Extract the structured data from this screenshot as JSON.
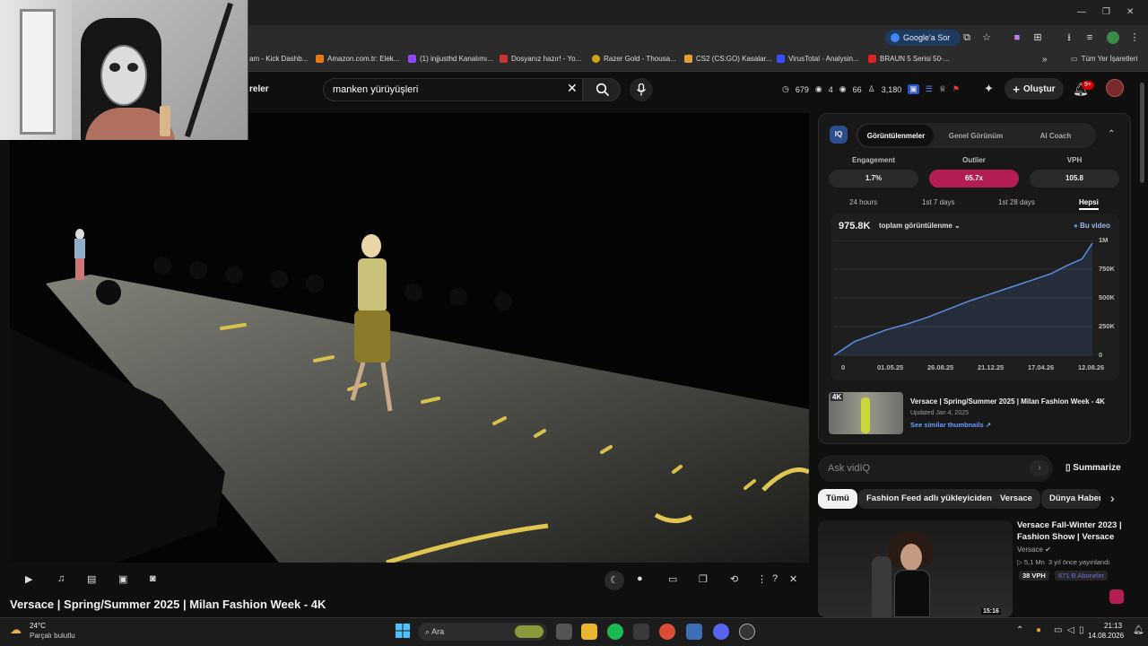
{
  "browser": {
    "google_btn": "Google'a Sor",
    "bookmarks": [
      {
        "label": "am - Kick Dashb..."
      },
      {
        "label": "Amazon.com.tr: Elek..."
      },
      {
        "label": "(1) injjusthd Kanalımı..."
      },
      {
        "label": "Dosyanız hazır! - Yo..."
      },
      {
        "label": "Razer Gold - Thousa..."
      },
      {
        "label": "CS2 (CS:GO) Kasalar..."
      },
      {
        "label": "VirusTotal - Analysin..."
      },
      {
        "label": "BRAUN 5 Serisi 50-..."
      }
    ],
    "all_bookmarks": "Tüm Yer İşaretleri",
    "bm_more": "»"
  },
  "yt": {
    "nav_label": "reler",
    "search_value": "manken yürüyüşleri",
    "stats": [
      "679",
      "4",
      "66",
      "3,180"
    ],
    "create_label": "Oluştur",
    "notif_count": "9+"
  },
  "video": {
    "title": "Versace | Spring/Summer 2025 | Milan Fashion Week - 4K"
  },
  "viq": {
    "logo": "IQ",
    "tabs": [
      "Görüntülenmeler",
      "Genel Görünüm",
      "AI Coach"
    ],
    "metrics": [
      {
        "label": "Engagement",
        "value": "1.7%"
      },
      {
        "label": "Outlier",
        "value": "65.7x"
      },
      {
        "label": "VPH",
        "value": "105.8"
      }
    ],
    "ranges": [
      "24 hours",
      "1st 7 days",
      "1st 28 days",
      "Hepsi"
    ],
    "views_total": "975.8K",
    "views_dropdown": "toplam görüntülenme",
    "legend": "Bu video",
    "related_title": "Versace | Spring/Summer 2025 | Milan Fashion Week - 4K",
    "related_updated": "Updated Jan 4, 2025",
    "related_link": "See similar thumbnails ↗",
    "related_badge": "4K"
  },
  "chart_data": {
    "type": "area",
    "title": "",
    "x": [
      "0",
      "01.05.25",
      "26.08.25",
      "21.12.25",
      "17.04.26",
      "12.08.26"
    ],
    "y_ticks": [
      "0",
      "250K",
      "500K",
      "750K",
      "1M"
    ],
    "ylim": [
      0,
      1000000
    ],
    "series": [
      {
        "name": "Bu video",
        "points": [
          [
            0,
            0
          ],
          [
            0.04,
            60000
          ],
          [
            0.08,
            120000
          ],
          [
            0.14,
            170000
          ],
          [
            0.2,
            220000
          ],
          [
            0.28,
            270000
          ],
          [
            0.36,
            330000
          ],
          [
            0.44,
            400000
          ],
          [
            0.52,
            470000
          ],
          [
            0.6,
            530000
          ],
          [
            0.68,
            590000
          ],
          [
            0.76,
            650000
          ],
          [
            0.84,
            710000
          ],
          [
            0.9,
            780000
          ],
          [
            0.96,
            840000
          ],
          [
            1.0,
            975800
          ]
        ]
      }
    ],
    "grid": true
  },
  "sidebar": {
    "ask_placeholder": "Ask vidIQ",
    "summarize_label": "Summarize",
    "chips": [
      "Tümü",
      "Fashion Feed adlı yükleyiciden",
      "Versace",
      "Dünya Haber"
    ],
    "rec": {
      "title_line1": "Versace Fall-Winter 2023 |",
      "title_line2": "Fashion Show | Versace",
      "channel": "Versace",
      "views": "5,1 Mn",
      "age": "3 yıl önce yayınlandı",
      "vph": "38 VPH",
      "subs": "671 B Aboneler",
      "duration": "15:16"
    }
  },
  "taskbar": {
    "temp": "24°C",
    "weather": "Parçalı bulutlu",
    "search": "Ara",
    "time": "21:13",
    "date": "14.08.2026"
  }
}
